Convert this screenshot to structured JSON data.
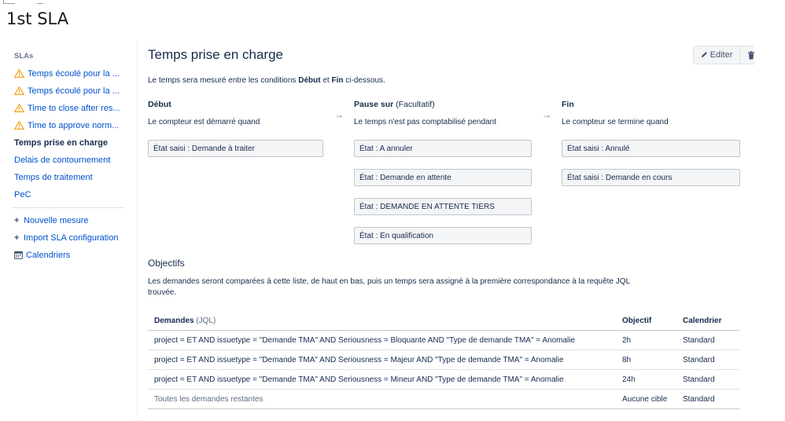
{
  "doc_title": "1st SLA",
  "sidebar": {
    "header": "SLAs",
    "items": [
      {
        "label": "Temps écoulé pour la ...",
        "warning": true
      },
      {
        "label": "Temps écoulé pour la ...",
        "warning": true
      },
      {
        "label": "Time to close after res...",
        "warning": true
      },
      {
        "label": "Time to approve norm...",
        "warning": true
      },
      {
        "label": "Temps prise en charge",
        "active": true
      },
      {
        "label": "Delais de contournement"
      },
      {
        "label": "Temps de traitement"
      },
      {
        "label": "PeC"
      }
    ],
    "actions": [
      {
        "label": "Nouvelle mesure",
        "icon": "plus-icon"
      },
      {
        "label": "Import SLA configuration",
        "icon": "plus-icon"
      },
      {
        "label": "Calendriers",
        "icon": "calendar-icon"
      }
    ]
  },
  "main": {
    "title": "Temps prise en charge",
    "edit_label": "Editer",
    "description": {
      "prefix": "Le temps sera mesuré entre les conditions ",
      "debut": "Début",
      "et": " et ",
      "fin": "Fin",
      "suffix": " ci-dessous."
    },
    "columns": {
      "start": {
        "title": "Début",
        "subtitle": "Le compteur est démarré quand",
        "states": [
          "État saisi : Demande à traiter"
        ]
      },
      "pause": {
        "title": "Pause sur",
        "optional": " (Facultatif)",
        "subtitle": "Le temps n'est pas comptabilisé pendant",
        "states": [
          "État : A annuler",
          "État : Demande en attente",
          "État : DEMANDE EN ATTENTE TIERS",
          "État : En qualification"
        ]
      },
      "stop": {
        "title": "Fin",
        "subtitle": "Le compteur se termine quand",
        "states": [
          "État saisi : Annulé",
          "État saisi : Demande en cours"
        ]
      },
      "arrow": "→"
    },
    "objectives": {
      "title": "Objectifs",
      "description": "Les demandes seront comparées à cette liste, de haut en bas, puis un temps sera assigné à la première correspondance à la requête JQL trouvée.",
      "headers": {
        "requests": "Demandes",
        "jql": " (JQL)",
        "goal": "Objectif",
        "calendar": "Calendrier"
      },
      "rows": [
        {
          "jql": "project = ET AND issuetype = \"Demande TMA\" AND Seriousness = Bloquante AND \"Type de demande TMA\" = Anomalie",
          "goal": "2h",
          "calendar": "Standard"
        },
        {
          "jql": "project = ET AND issuetype = \"Demande TMA\" AND Seriousness = Majeur AND \"Type de demande TMA\" = Anomalie",
          "goal": "8h",
          "calendar": "Standard"
        },
        {
          "jql": "project = ET AND issuetype = \"Demande TMA\" AND Seriousness = Mineur AND \"Type de demande TMA\" = Anomalie",
          "goal": "24h",
          "calendar": "Standard"
        },
        {
          "jql": "Toutes les demandes restantes",
          "goal": "Aucune cible",
          "calendar": "Standard"
        }
      ]
    }
  },
  "colors": {
    "link": "#0052cc",
    "warning": "#ffab00",
    "text": "#172b4d"
  }
}
